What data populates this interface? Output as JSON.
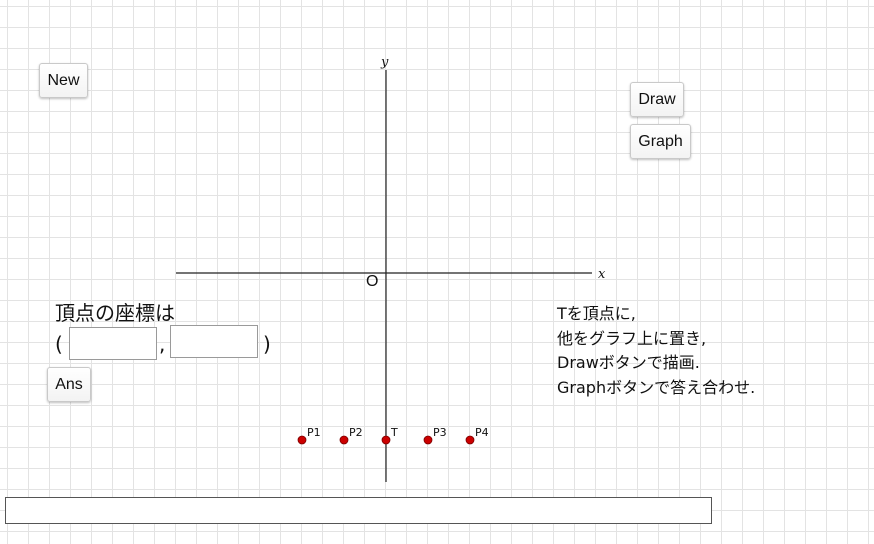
{
  "buttons": {
    "new_label": "New",
    "draw_label": "Draw",
    "graph_label": "Graph",
    "ans_label": "Ans"
  },
  "axes": {
    "x_label": "x",
    "y_label": "y",
    "origin_label": "O"
  },
  "points": [
    {
      "label": "P1",
      "color": "#cc0000"
    },
    {
      "label": "P2",
      "color": "#cc0000"
    },
    {
      "label": "T",
      "color": "#cc0000"
    },
    {
      "label": "P3",
      "color": "#cc0000"
    },
    {
      "label": "P4",
      "color": "#cc0000"
    }
  ],
  "vertex": {
    "prompt": "頂点の座標は",
    "open_paren": "(",
    "comma": ",",
    "close_paren": ")",
    "x_value": "",
    "y_value": ""
  },
  "instructions": [
    "Tを頂点に,",
    "他をグラフ上に置き,",
    "Drawボタンで描画.",
    "Graphボタンで答え合わせ."
  ],
  "answer_field": {
    "value": ""
  }
}
